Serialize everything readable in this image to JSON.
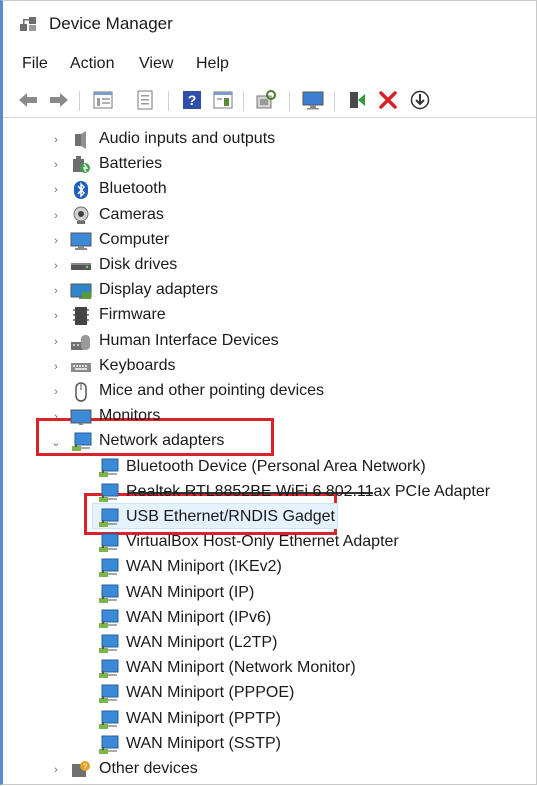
{
  "window": {
    "title": "Device Manager"
  },
  "menu": [
    "File",
    "Action",
    "View",
    "Help"
  ],
  "toolbar": [
    "back-icon",
    "forward-icon",
    "properties-icon",
    "show-hidden-icon",
    "help-icon",
    "action-view-icon",
    "scan-hardware-icon",
    "monitor-icon",
    "enable-driver-icon",
    "uninstall-icon",
    "update-driver-icon"
  ],
  "categories": [
    {
      "label": "Audio inputs and outputs",
      "icon": "speaker-icon"
    },
    {
      "label": "Batteries",
      "icon": "battery-icon"
    },
    {
      "label": "Bluetooth",
      "icon": "bluetooth-icon"
    },
    {
      "label": "Cameras",
      "icon": "camera-icon"
    },
    {
      "label": "Computer",
      "icon": "computer-icon"
    },
    {
      "label": "Disk drives",
      "icon": "disk-drive-icon"
    },
    {
      "label": "Display adapters",
      "icon": "display-adapter-icon"
    },
    {
      "label": "Firmware",
      "icon": "firmware-icon"
    },
    {
      "label": "Human Interface Devices",
      "icon": "hid-icon"
    },
    {
      "label": "Keyboards",
      "icon": "keyboard-icon"
    },
    {
      "label": "Mice and other pointing devices",
      "icon": "mouse-icon"
    },
    {
      "label": "Monitors",
      "icon": "monitor-icon"
    },
    {
      "label": "Network adapters",
      "icon": "network-adapter-icon",
      "expanded": true
    }
  ],
  "network_adapters": [
    "Bluetooth Device (Personal Area Network)",
    "Realtek RTL8852BE WiFi 6 802.11ax PCIe Adapter",
    "USB Ethernet/RNDIS Gadget",
    "VirtualBox Host-Only Ethernet Adapter",
    "WAN Miniport (IKEv2)",
    "WAN Miniport (IP)",
    "WAN Miniport (IPv6)",
    "WAN Miniport (L2TP)",
    "WAN Miniport (Network Monitor)",
    "WAN Miniport (PPPOE)",
    "WAN Miniport (PPTP)",
    "WAN Miniport (SSTP)"
  ],
  "trailing_category": {
    "label": "Other devices",
    "icon": "other-devices-icon"
  },
  "selected_item": "USB Ethernet/RNDIS Gadget",
  "colors": {
    "highlight": "#d9222a",
    "selection": "#e5f1fb",
    "accent": "#5a8ad6"
  }
}
